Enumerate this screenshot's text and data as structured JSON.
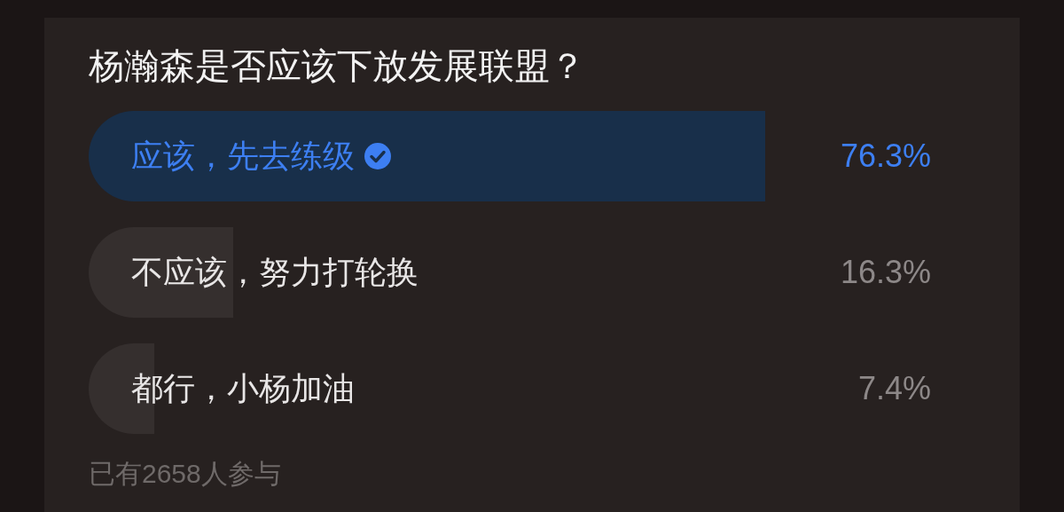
{
  "poll": {
    "question": "杨瀚森是否应该下放发展联盟？",
    "options": [
      {
        "label": "应该，先去练级",
        "percent": "76.3%",
        "level": 0.763,
        "selected": true
      },
      {
        "label": "不应该，努力打轮换",
        "percent": "16.3%",
        "level": 0.163,
        "selected": false
      },
      {
        "label": "都行，小杨加油",
        "percent": "7.4%",
        "level": 0.074,
        "selected": false
      }
    ],
    "participants": "已有2658人参与"
  }
}
